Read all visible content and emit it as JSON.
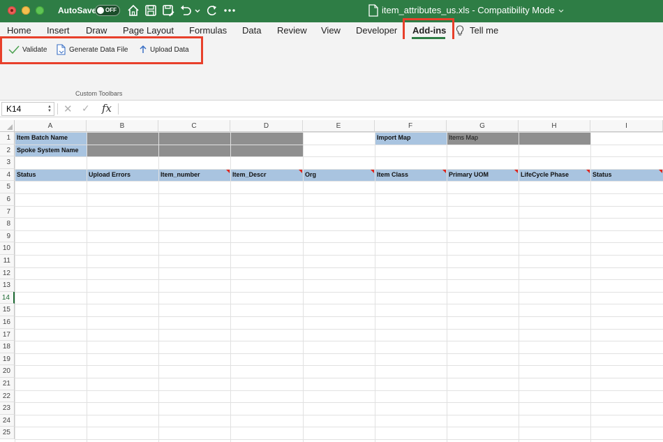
{
  "titlebar": {
    "autosave_label": "AutoSave",
    "autosave_state": "OFF",
    "title": "item_attributes_us.xls  -  Compatibility Mode",
    "bg": "#2e7d45"
  },
  "tabs": [
    "Home",
    "Insert",
    "Draw",
    "Page Layout",
    "Formulas",
    "Data",
    "Review",
    "View",
    "Developer",
    "Add-ins"
  ],
  "tell_me": "Tell me",
  "toolbar": {
    "validate": "Validate",
    "generate": "Generate Data File",
    "upload": "Upload Data",
    "group_label": "Custom Toolbars"
  },
  "formula_bar": {
    "name_box": "K14",
    "fx": "fx",
    "value": ""
  },
  "grid": {
    "columns": [
      "A",
      "B",
      "C",
      "D",
      "E",
      "F",
      "G",
      "H",
      "I"
    ],
    "rows": [
      "1",
      "2",
      "3",
      "4",
      "5",
      "6",
      "7",
      "8",
      "9",
      "10",
      "11",
      "12",
      "13",
      "14",
      "15",
      "16",
      "17",
      "18",
      "19",
      "20",
      "21",
      "22",
      "23",
      "24",
      "25"
    ],
    "selected_row": "14",
    "cells": {
      "A1": "Item Batch Name",
      "A2": "Spoke System Name",
      "F1": "Import Map",
      "G1": "Items Map",
      "A4": "Status",
      "B4": "Upload Errors",
      "C4": "Item_number",
      "D4": "Item_Descr",
      "E4": "Org",
      "F4": "Item Class",
      "G4": "Primary UOM",
      "H4": "LifeCycle Phase",
      "I4": "Status"
    },
    "header_fill": "#a9c4e0",
    "gray_fill": "#8f8f8f"
  }
}
